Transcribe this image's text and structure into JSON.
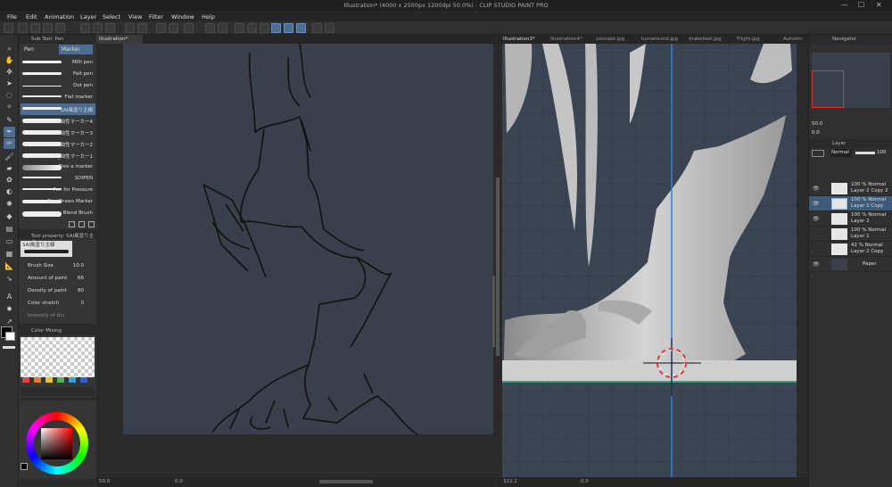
{
  "window": {
    "title": "Illustration* (4000 x 2500px 1200dpi 50.0%) - CLIP STUDIO PAINT PRO",
    "controls": [
      "—",
      "☐",
      "✕"
    ]
  },
  "menu": [
    "File",
    "Edit",
    "Animation",
    "Layer",
    "Select",
    "View",
    "Filter",
    "Window",
    "Help"
  ],
  "subtool": {
    "header": "Sub Tool: Pen",
    "tabs": [
      "Pen",
      "Marker"
    ],
    "brushes": [
      "Milli pen",
      "Felt pen",
      "Dot pen",
      "Flat marker",
      "SAI風塗り主線",
      "油性マーカー4",
      "油性マーカー3",
      "油性マーカー2",
      "3_油性マーカー1",
      "Tree a marker",
      "SOIPEN",
      "Pen for Pressure",
      "RossDraws Marker",
      "Blend Brush"
    ]
  },
  "toolprop": {
    "header": "Tool property: SAI風塗り主線",
    "preview_label": "SAI風塗り主線",
    "rows": [
      {
        "label": "Brush Size",
        "value": "10.0"
      },
      {
        "label": "Amount of paint",
        "value": "66"
      },
      {
        "label": "Density of paint",
        "value": "80"
      },
      {
        "label": "Color stretch",
        "value": "0"
      },
      {
        "label": "Intensity of blu",
        "value": ""
      }
    ]
  },
  "colormix": {
    "header": "Color Mixing"
  },
  "swatches": [
    "#d94848",
    "#e07a30",
    "#e7c33a",
    "#53b25a",
    "#3aa0d0",
    "#2f5fc8"
  ],
  "left_doc": {
    "tab": "Illustration*",
    "zoom": "50.0",
    "angle": "0.0"
  },
  "right_doc": {
    "tabs": [
      "Illustration3*",
      "Illustration4*",
      "concept.jpg",
      "turnaround.jpg",
      "drakefeet.jpg",
      "Flight.jpg",
      "Autumn"
    ],
    "zoom": "322.1",
    "angle": "0.0"
  },
  "navigator": {
    "header": "Navigator",
    "zoom": "50.0",
    "angle": "0.0"
  },
  "layers": {
    "header": "Layer",
    "blend": "Normal",
    "opacity": "100",
    "items": [
      {
        "opacity": "100 %",
        "mode": "Normal",
        "name": "Layer 2 Copy 2",
        "eye": "👁",
        "selected": false
      },
      {
        "opacity": "100 %",
        "mode": "Normal",
        "name": "Layer 1 Copy",
        "eye": "👁",
        "selected": true
      },
      {
        "opacity": "100 %",
        "mode": "Normal",
        "name": "Layer 2",
        "eye": "👁",
        "selected": false
      },
      {
        "opacity": "100 %",
        "mode": "Normal",
        "name": "Layer 1",
        "eye": "",
        "selected": false
      },
      {
        "opacity": "42 %",
        "mode": "Normal",
        "name": "Layer 2 Copy",
        "eye": "",
        "selected": false
      },
      {
        "opacity": "",
        "mode": "",
        "name": "Paper",
        "eye": "👁",
        "selected": false
      }
    ]
  },
  "colors": {
    "accent": "#4d6c8f",
    "canvas": "#3a404b",
    "sky": "#3a4453",
    "ground_line": "#2fa37a",
    "axis": "#3d7bd2"
  }
}
